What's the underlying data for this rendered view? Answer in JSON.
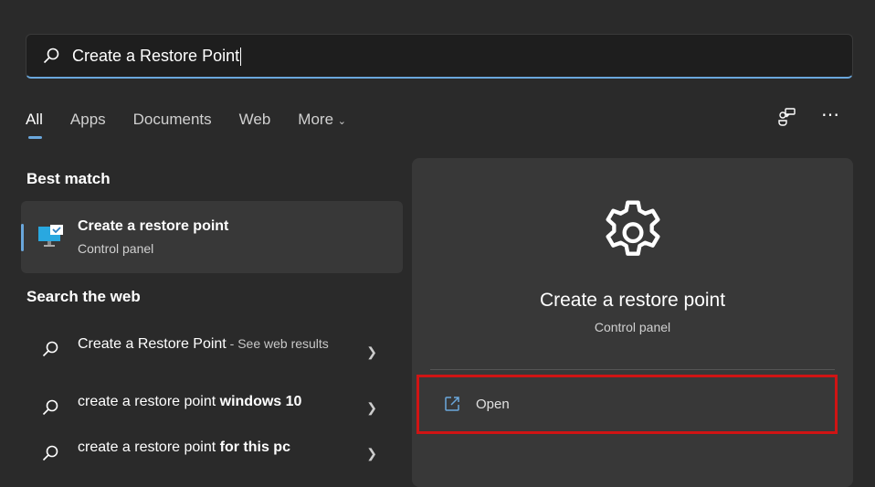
{
  "search": {
    "value": "Create a Restore Point",
    "icon": "search-icon"
  },
  "tabs": [
    {
      "label": "All"
    },
    {
      "label": "Apps"
    },
    {
      "label": "Documents"
    },
    {
      "label": "Web"
    },
    {
      "label": "More"
    }
  ],
  "sections": {
    "best_match": "Best match",
    "search_web": "Search the web"
  },
  "best_match": {
    "title": "Create a restore point",
    "subtitle": "Control panel"
  },
  "web_results": [
    {
      "plain": "Create a Restore Point",
      "bold": "",
      "suffix": " - See web results"
    },
    {
      "plain": "create a restore point ",
      "bold": "windows 10",
      "suffix": ""
    },
    {
      "plain": "create a restore point ",
      "bold": "for this pc",
      "suffix": ""
    }
  ],
  "preview": {
    "title": "Create a restore point",
    "subtitle": "Control panel",
    "action": "Open"
  },
  "colors": {
    "accent": "#6aa7dc",
    "highlight": "#d01414"
  }
}
